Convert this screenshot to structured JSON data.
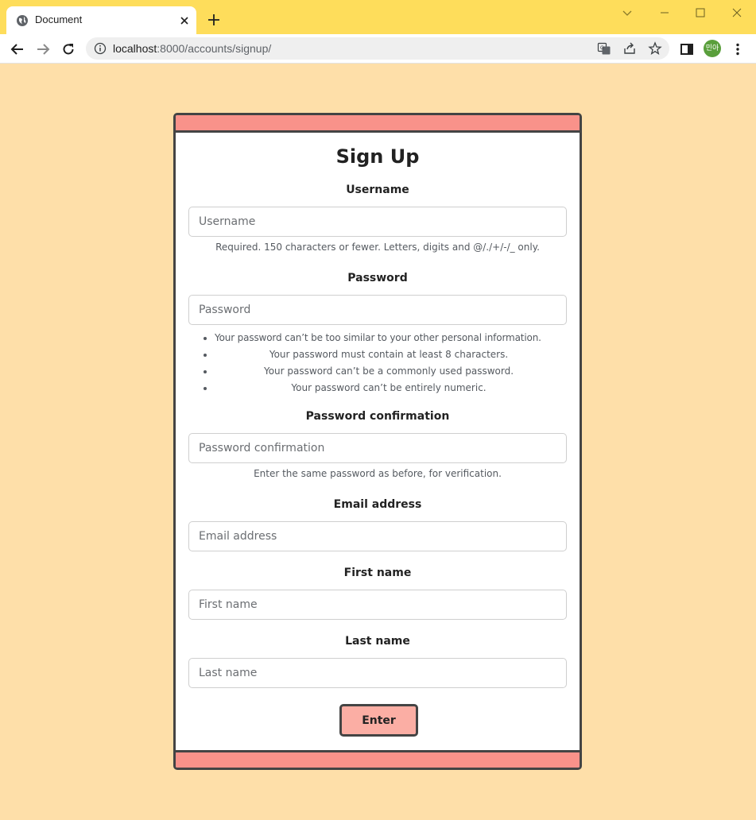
{
  "browser": {
    "tab_title": "Document",
    "url_host": "localhost",
    "url_path": ":8000/accounts/signup/",
    "profile_initials": "민아"
  },
  "form": {
    "title": "Sign Up",
    "fields": {
      "username": {
        "label": "Username",
        "placeholder": "Username",
        "help": "Required. 150 characters or fewer. Letters, digits and @/./+/-/_ only."
      },
      "password": {
        "label": "Password",
        "placeholder": "Password",
        "rules": [
          "Your password can’t be too similar to your other personal information.",
          "Your password must contain at least 8 characters.",
          "Your password can’t be a commonly used password.",
          "Your password can’t be entirely numeric."
        ]
      },
      "password_confirmation": {
        "label": "Password confirmation",
        "placeholder": "Password confirmation",
        "help": "Enter the same password as before, for verification."
      },
      "email": {
        "label": "Email address",
        "placeholder": "Email address"
      },
      "first_name": {
        "label": "First name",
        "placeholder": "First name"
      },
      "last_name": {
        "label": "Last name",
        "placeholder": "Last name"
      }
    },
    "submit_label": "Enter"
  },
  "colors": {
    "page_background": "#fedfa9",
    "titlebar": "#fedd5b",
    "card_band": "#f9928a",
    "button": "#fbaea4",
    "border": "#444444"
  }
}
